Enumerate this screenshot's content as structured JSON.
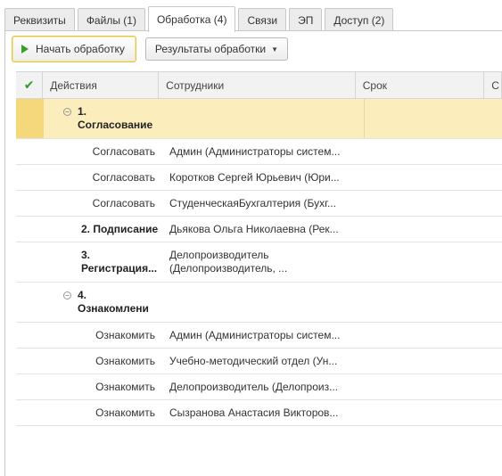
{
  "tabs": [
    {
      "label": "Реквизиты"
    },
    {
      "label": "Файлы (1)"
    },
    {
      "label": "Обработка (4)"
    },
    {
      "label": "Связи"
    },
    {
      "label": "ЭП"
    },
    {
      "label": "Доступ (2)"
    }
  ],
  "toolbar": {
    "start_label": "Начать обработку",
    "results_label": "Результаты обработки"
  },
  "grid": {
    "columns": [
      "Действия",
      "Сотрудники",
      "Срок",
      "С"
    ],
    "rows": [
      {
        "action_line1": "1.",
        "action_line2": "Согласование",
        "employee": ""
      },
      {
        "action": "Согласовать",
        "employee": "Админ (Администраторы систем..."
      },
      {
        "action": "Согласовать",
        "employee": "Коротков Сергей Юрьевич (Юри..."
      },
      {
        "action": "Согласовать",
        "employee": "СтуденческаяБухгалтерия (Бухг..."
      },
      {
        "action": "2. Подписание",
        "employee": "Дьякова Ольга Николаевна (Рек..."
      },
      {
        "action_line1": "3.",
        "action_line2": "Регистрация...",
        "employee_line1": "Делопроизводитель",
        "employee_line2": "(Делопроизводитель, ..."
      },
      {
        "action_line1": "4.",
        "action_line2": "Ознакомлени",
        "employee": ""
      },
      {
        "action": "Ознакомить",
        "employee": "Админ (Администраторы систем..."
      },
      {
        "action": "Ознакомить",
        "employee": "Учебно-методический отдел (Ун..."
      },
      {
        "action": "Ознакомить",
        "employee": "Делопроизводитель (Делопроиз..."
      },
      {
        "action": "Ознакомить",
        "employee": "Сызранова Анастасия Викторов..."
      }
    ]
  },
  "colors": {
    "selection": "#fbeebc",
    "accent_green": "#3c9b2e"
  }
}
